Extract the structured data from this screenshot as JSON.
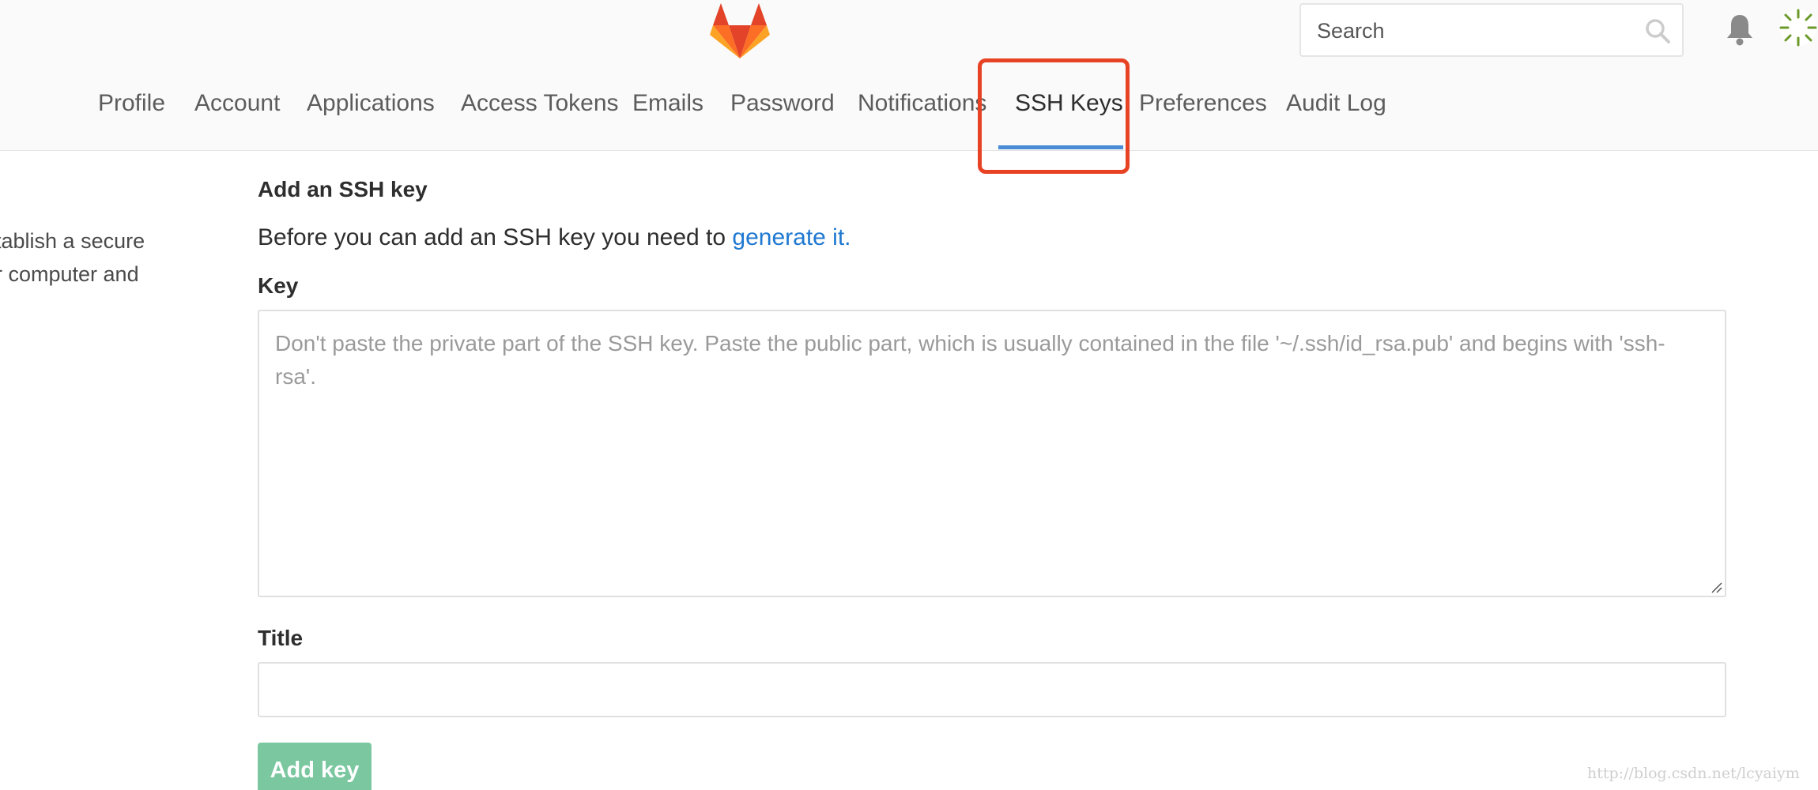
{
  "header": {
    "search": {
      "placeholder": "Search"
    }
  },
  "tabs": [
    {
      "label": "Profile"
    },
    {
      "label": "Account"
    },
    {
      "label": "Applications"
    },
    {
      "label": "Access Tokens"
    },
    {
      "label": "Emails"
    },
    {
      "label": "Password"
    },
    {
      "label": "Notifications"
    },
    {
      "label": "SSH Keys",
      "active": true
    },
    {
      "label": "Preferences"
    },
    {
      "label": "Audit Log"
    }
  ],
  "sidebar": {
    "lines": [
      "tablish a secure",
      "r computer and"
    ]
  },
  "form": {
    "section_title": "Add an SSH key",
    "intro_text": "Before you can add an SSH key you need to ",
    "intro_link": "generate it.",
    "key_label": "Key",
    "key_placeholder": "Don't paste the private part of the SSH key. Paste the public part, which is usually contained in the file '~/.ssh/id_rsa.pub' and begins with 'ssh-rsa'.",
    "title_label": "Title",
    "title_value": "",
    "submit_label": "Add key"
  },
  "watermark": "http://blog.csdn.net/lcyaiym",
  "colors": {
    "accent": "#e84225",
    "link": "#1f78d1",
    "tab_underline": "#4a8bd6",
    "submit": "#7ac7a0"
  }
}
